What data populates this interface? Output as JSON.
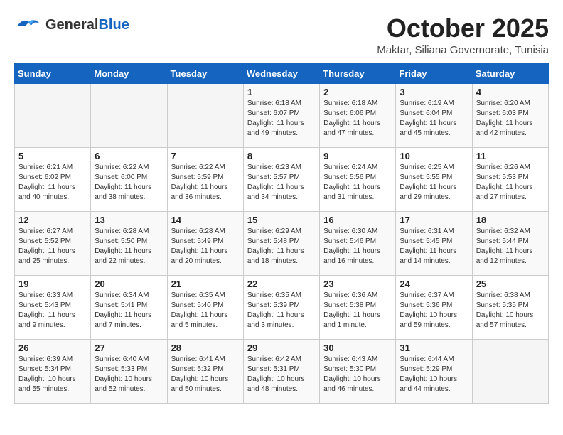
{
  "header": {
    "logo": {
      "general": "General",
      "blue": "Blue"
    },
    "month_title": "October 2025",
    "location": "Maktar, Siliana Governorate, Tunisia"
  },
  "calendar": {
    "days_of_week": [
      "Sunday",
      "Monday",
      "Tuesday",
      "Wednesday",
      "Thursday",
      "Friday",
      "Saturday"
    ],
    "weeks": [
      [
        {
          "day": "",
          "info": ""
        },
        {
          "day": "",
          "info": ""
        },
        {
          "day": "",
          "info": ""
        },
        {
          "day": "1",
          "info": "Sunrise: 6:18 AM\nSunset: 6:07 PM\nDaylight: 11 hours\nand 49 minutes."
        },
        {
          "day": "2",
          "info": "Sunrise: 6:18 AM\nSunset: 6:06 PM\nDaylight: 11 hours\nand 47 minutes."
        },
        {
          "day": "3",
          "info": "Sunrise: 6:19 AM\nSunset: 6:04 PM\nDaylight: 11 hours\nand 45 minutes."
        },
        {
          "day": "4",
          "info": "Sunrise: 6:20 AM\nSunset: 6:03 PM\nDaylight: 11 hours\nand 42 minutes."
        }
      ],
      [
        {
          "day": "5",
          "info": "Sunrise: 6:21 AM\nSunset: 6:02 PM\nDaylight: 11 hours\nand 40 minutes."
        },
        {
          "day": "6",
          "info": "Sunrise: 6:22 AM\nSunset: 6:00 PM\nDaylight: 11 hours\nand 38 minutes."
        },
        {
          "day": "7",
          "info": "Sunrise: 6:22 AM\nSunset: 5:59 PM\nDaylight: 11 hours\nand 36 minutes."
        },
        {
          "day": "8",
          "info": "Sunrise: 6:23 AM\nSunset: 5:57 PM\nDaylight: 11 hours\nand 34 minutes."
        },
        {
          "day": "9",
          "info": "Sunrise: 6:24 AM\nSunset: 5:56 PM\nDaylight: 11 hours\nand 31 minutes."
        },
        {
          "day": "10",
          "info": "Sunrise: 6:25 AM\nSunset: 5:55 PM\nDaylight: 11 hours\nand 29 minutes."
        },
        {
          "day": "11",
          "info": "Sunrise: 6:26 AM\nSunset: 5:53 PM\nDaylight: 11 hours\nand 27 minutes."
        }
      ],
      [
        {
          "day": "12",
          "info": "Sunrise: 6:27 AM\nSunset: 5:52 PM\nDaylight: 11 hours\nand 25 minutes."
        },
        {
          "day": "13",
          "info": "Sunrise: 6:28 AM\nSunset: 5:50 PM\nDaylight: 11 hours\nand 22 minutes."
        },
        {
          "day": "14",
          "info": "Sunrise: 6:28 AM\nSunset: 5:49 PM\nDaylight: 11 hours\nand 20 minutes."
        },
        {
          "day": "15",
          "info": "Sunrise: 6:29 AM\nSunset: 5:48 PM\nDaylight: 11 hours\nand 18 minutes."
        },
        {
          "day": "16",
          "info": "Sunrise: 6:30 AM\nSunset: 5:46 PM\nDaylight: 11 hours\nand 16 minutes."
        },
        {
          "day": "17",
          "info": "Sunrise: 6:31 AM\nSunset: 5:45 PM\nDaylight: 11 hours\nand 14 minutes."
        },
        {
          "day": "18",
          "info": "Sunrise: 6:32 AM\nSunset: 5:44 PM\nDaylight: 11 hours\nand 12 minutes."
        }
      ],
      [
        {
          "day": "19",
          "info": "Sunrise: 6:33 AM\nSunset: 5:43 PM\nDaylight: 11 hours\nand 9 minutes."
        },
        {
          "day": "20",
          "info": "Sunrise: 6:34 AM\nSunset: 5:41 PM\nDaylight: 11 hours\nand 7 minutes."
        },
        {
          "day": "21",
          "info": "Sunrise: 6:35 AM\nSunset: 5:40 PM\nDaylight: 11 hours\nand 5 minutes."
        },
        {
          "day": "22",
          "info": "Sunrise: 6:35 AM\nSunset: 5:39 PM\nDaylight: 11 hours\nand 3 minutes."
        },
        {
          "day": "23",
          "info": "Sunrise: 6:36 AM\nSunset: 5:38 PM\nDaylight: 11 hours\nand 1 minute."
        },
        {
          "day": "24",
          "info": "Sunrise: 6:37 AM\nSunset: 5:36 PM\nDaylight: 10 hours\nand 59 minutes."
        },
        {
          "day": "25",
          "info": "Sunrise: 6:38 AM\nSunset: 5:35 PM\nDaylight: 10 hours\nand 57 minutes."
        }
      ],
      [
        {
          "day": "26",
          "info": "Sunrise: 6:39 AM\nSunset: 5:34 PM\nDaylight: 10 hours\nand 55 minutes."
        },
        {
          "day": "27",
          "info": "Sunrise: 6:40 AM\nSunset: 5:33 PM\nDaylight: 10 hours\nand 52 minutes."
        },
        {
          "day": "28",
          "info": "Sunrise: 6:41 AM\nSunset: 5:32 PM\nDaylight: 10 hours\nand 50 minutes."
        },
        {
          "day": "29",
          "info": "Sunrise: 6:42 AM\nSunset: 5:31 PM\nDaylight: 10 hours\nand 48 minutes."
        },
        {
          "day": "30",
          "info": "Sunrise: 6:43 AM\nSunset: 5:30 PM\nDaylight: 10 hours\nand 46 minutes."
        },
        {
          "day": "31",
          "info": "Sunrise: 6:44 AM\nSunset: 5:29 PM\nDaylight: 10 hours\nand 44 minutes."
        },
        {
          "day": "",
          "info": ""
        }
      ]
    ]
  }
}
